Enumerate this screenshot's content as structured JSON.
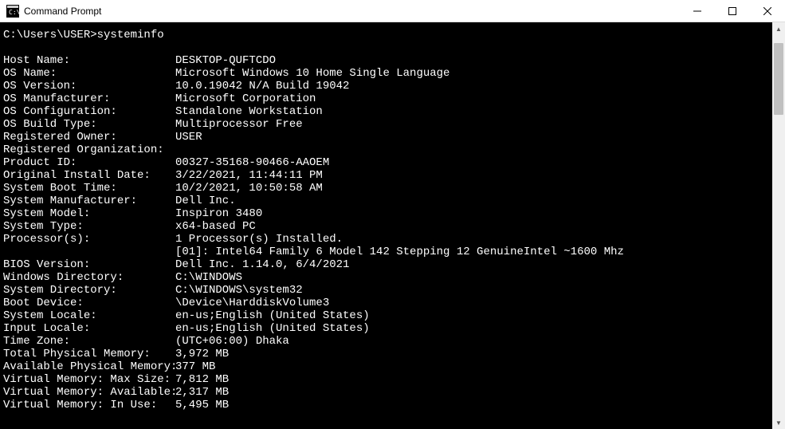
{
  "window": {
    "title": "Command Prompt"
  },
  "terminal": {
    "prompt": "C:\\Users\\USER>",
    "command": "systeminfo",
    "rows": [
      {
        "label": "Host Name:",
        "value": "DESKTOP-QUFTCDO"
      },
      {
        "label": "OS Name:",
        "value": "Microsoft Windows 10 Home Single Language"
      },
      {
        "label": "OS Version:",
        "value": "10.0.19042 N/A Build 19042"
      },
      {
        "label": "OS Manufacturer:",
        "value": "Microsoft Corporation"
      },
      {
        "label": "OS Configuration:",
        "value": "Standalone Workstation"
      },
      {
        "label": "OS Build Type:",
        "value": "Multiprocessor Free"
      },
      {
        "label": "Registered Owner:",
        "value": "USER"
      },
      {
        "label": "Registered Organization:",
        "value": ""
      },
      {
        "label": "Product ID:",
        "value": "00327-35168-90466-AAOEM"
      },
      {
        "label": "Original Install Date:",
        "value": "3/22/2021, 11:44:11 PM"
      },
      {
        "label": "System Boot Time:",
        "value": "10/2/2021, 10:50:58 AM"
      },
      {
        "label": "System Manufacturer:",
        "value": "Dell Inc."
      },
      {
        "label": "System Model:",
        "value": "Inspiron 3480"
      },
      {
        "label": "System Type:",
        "value": "x64-based PC"
      },
      {
        "label": "Processor(s):",
        "value": "1 Processor(s) Installed."
      },
      {
        "label": "",
        "value": "[01]: Intel64 Family 6 Model 142 Stepping 12 GenuineIntel ~1600 Mhz"
      },
      {
        "label": "BIOS Version:",
        "value": "Dell Inc. 1.14.0, 6/4/2021"
      },
      {
        "label": "Windows Directory:",
        "value": "C:\\WINDOWS"
      },
      {
        "label": "System Directory:",
        "value": "C:\\WINDOWS\\system32"
      },
      {
        "label": "Boot Device:",
        "value": "\\Device\\HarddiskVolume3"
      },
      {
        "label": "System Locale:",
        "value": "en-us;English (United States)"
      },
      {
        "label": "Input Locale:",
        "value": "en-us;English (United States)"
      },
      {
        "label": "Time Zone:",
        "value": "(UTC+06:00) Dhaka"
      },
      {
        "label": "Total Physical Memory:",
        "value": "3,972 MB"
      },
      {
        "label": "Available Physical Memory:",
        "value": "377 MB"
      },
      {
        "label": "Virtual Memory: Max Size:",
        "value": "7,812 MB"
      },
      {
        "label": "Virtual Memory: Available:",
        "value": "2,317 MB"
      },
      {
        "label": "Virtual Memory: In Use:",
        "value": "5,495 MB"
      }
    ]
  }
}
